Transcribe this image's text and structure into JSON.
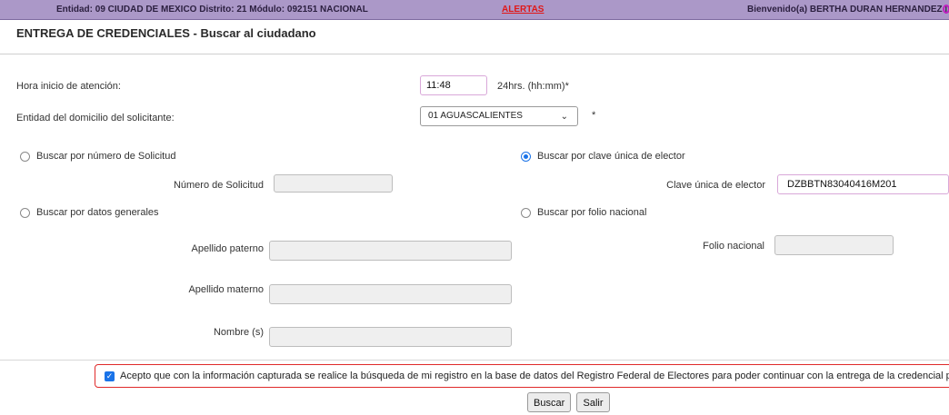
{
  "header": {
    "location": "Entidad: 09 CIUDAD DE MEXICO Distrito: 21 Módulo: 092151 NACIONAL",
    "alerts": "ALERTAS",
    "welcome": "Bienvenido(a) BERTHA DURAN HERNANDEZ  |"
  },
  "page": {
    "title": "ENTREGA DE CREDENCIALES - Buscar al ciudadano"
  },
  "form": {
    "hora_label": "Hora inicio de atención:",
    "hora_value": "11:48",
    "hora_hint": "24hrs. (hh:mm)*",
    "entidad_label": "Entidad  del domicilio del solicitante:",
    "entidad_value": "01 AGUASCALIENTES",
    "entidad_required": "*",
    "search_by_solicitud": "Buscar por número de Solicitud",
    "numero_solicitud_label": "Número de Solicitud",
    "numero_solicitud_value": "",
    "search_by_clave": "Buscar por clave única de elector",
    "clave_label": "Clave única de elector",
    "clave_value": "DZBBTN83040416M201",
    "search_by_datos": "Buscar por datos generales",
    "search_by_folio": "Buscar por folio nacional",
    "apellido_paterno_label": "Apellido paterno",
    "apellido_materno_label": "Apellido materno",
    "nombre_label": "Nombre (s)",
    "folio_label": "Folio nacional",
    "selected_search": "clave"
  },
  "consent": {
    "checked": true,
    "text": "Acepto que con la información capturada se realice la búsqueda de mi registro en la base de datos del Registro Federal de Electores para poder continuar con la entrega de la credencial para votar"
  },
  "buttons": {
    "buscar": "Buscar",
    "salir": "Salir"
  },
  "colors": {
    "header_bg": "#ab98c8",
    "alert": "#e01818",
    "accent": "#1a73e8",
    "consent_border": "#e02a2a"
  }
}
